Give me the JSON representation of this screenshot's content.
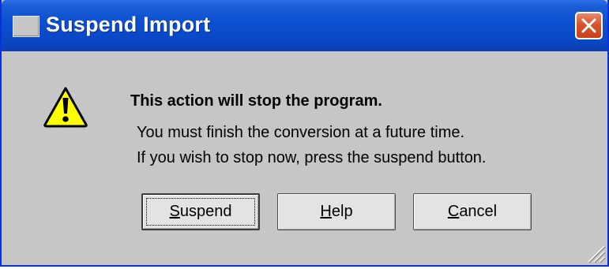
{
  "window": {
    "title": "Suspend Import",
    "title_icon": "window-icon",
    "close_icon": "close-icon"
  },
  "message": {
    "icon": "warning-icon",
    "headline": "This action will stop the program.",
    "line1": "You must finish the conversion at a future time.",
    "line2": "If you wish to stop now, press the suspend button."
  },
  "buttons": {
    "suspend": {
      "mnemonic": "S",
      "rest": "uspend"
    },
    "help": {
      "mnemonic": "H",
      "rest": "elp"
    },
    "cancel": {
      "mnemonic": "C",
      "rest": "ancel"
    }
  },
  "colors": {
    "titlebar": "#0b4fd0",
    "dialog_bg": "#c6c6c6",
    "close_button": "#d8542d",
    "warning_fill": "#ffff00"
  }
}
